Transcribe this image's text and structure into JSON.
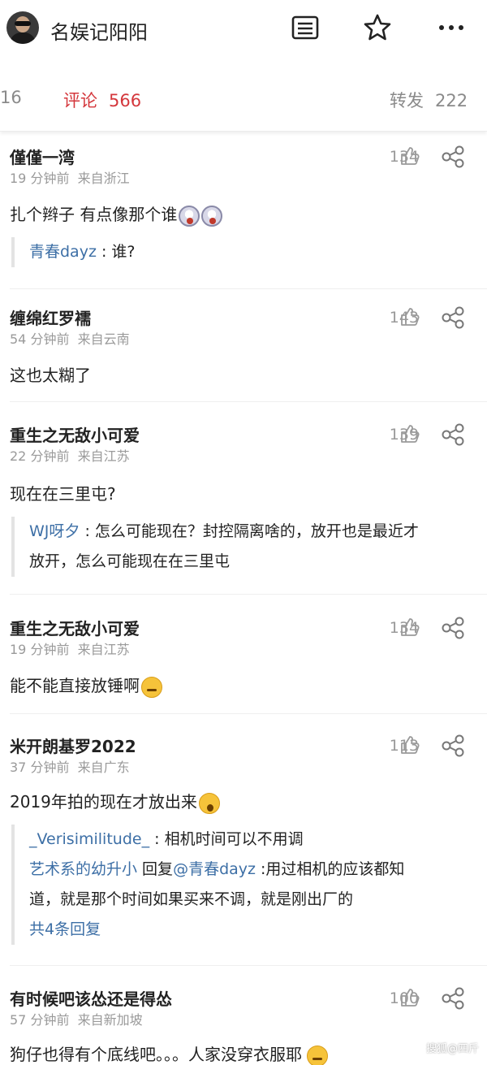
{
  "header": {
    "title": "名娱记阳阳",
    "icons": [
      "avatar",
      "article-list-icon",
      "star-icon",
      "more-icon"
    ]
  },
  "tabs": {
    "left_count": "16",
    "comments_label": "评论",
    "comments_count": "566",
    "repost_label": "转发",
    "repost_count": "222"
  },
  "comments": [
    {
      "name": "僅僅一湾",
      "time": "19 分钟前",
      "location": "来自浙江",
      "likes": "134",
      "text": "扎个辫子 有点像那个谁",
      "emoji": "scared-emoji x2",
      "reply": {
        "name": "青春dayz",
        "text": ": 谁?"
      }
    },
    {
      "name": "缠绵红罗襦",
      "time": "54 分钟前",
      "location": "来自云南",
      "likes": "143",
      "text": "这也太糊了"
    },
    {
      "name": "重生之无敌小可爱",
      "time": "22 分钟前",
      "location": "来自江苏",
      "likes": "139",
      "text": "现在在三里屯?",
      "reply": {
        "name": "WJ呀夕",
        "text": ": 怎么可能现在？封控隔离啥的，放开也是最近才",
        "text2": "放开，怎么可能现在在三里屯"
      }
    },
    {
      "name": "重生之无敌小可爱",
      "time": "19 分钟前",
      "location": "来自江苏",
      "likes": "134",
      "text": "能不能直接放锤啊",
      "emoji": "sleepy-emoji"
    },
    {
      "name": "米开朗基罗2022",
      "time": "37 分钟前",
      "location": "来自广东",
      "likes": "113",
      "text": "2019年拍的现在才放出来",
      "emoji": "shocked-emoji",
      "reply": {
        "name": "_Verisimilitude_",
        "text": ": 相机时间可以不用调",
        "name2": "艺术系的幼升小",
        "reply_word": " 回复",
        "mention": "@青春dayz",
        "text2": " :用过相机的应该都知",
        "text3": "道，就是那个时间如果买来不调，就是刚出厂的",
        "more": "共4条回复"
      }
    },
    {
      "name": "有时候吧该怂还是得怂",
      "time": "57 分钟前",
      "location": "来自新加坡",
      "likes": "100",
      "text": "狗仔也得有个底线吧。。。人家没穿衣服耶",
      "emoji": "sleepy-emoji"
    }
  ],
  "watermark": "搜狐@四斤"
}
